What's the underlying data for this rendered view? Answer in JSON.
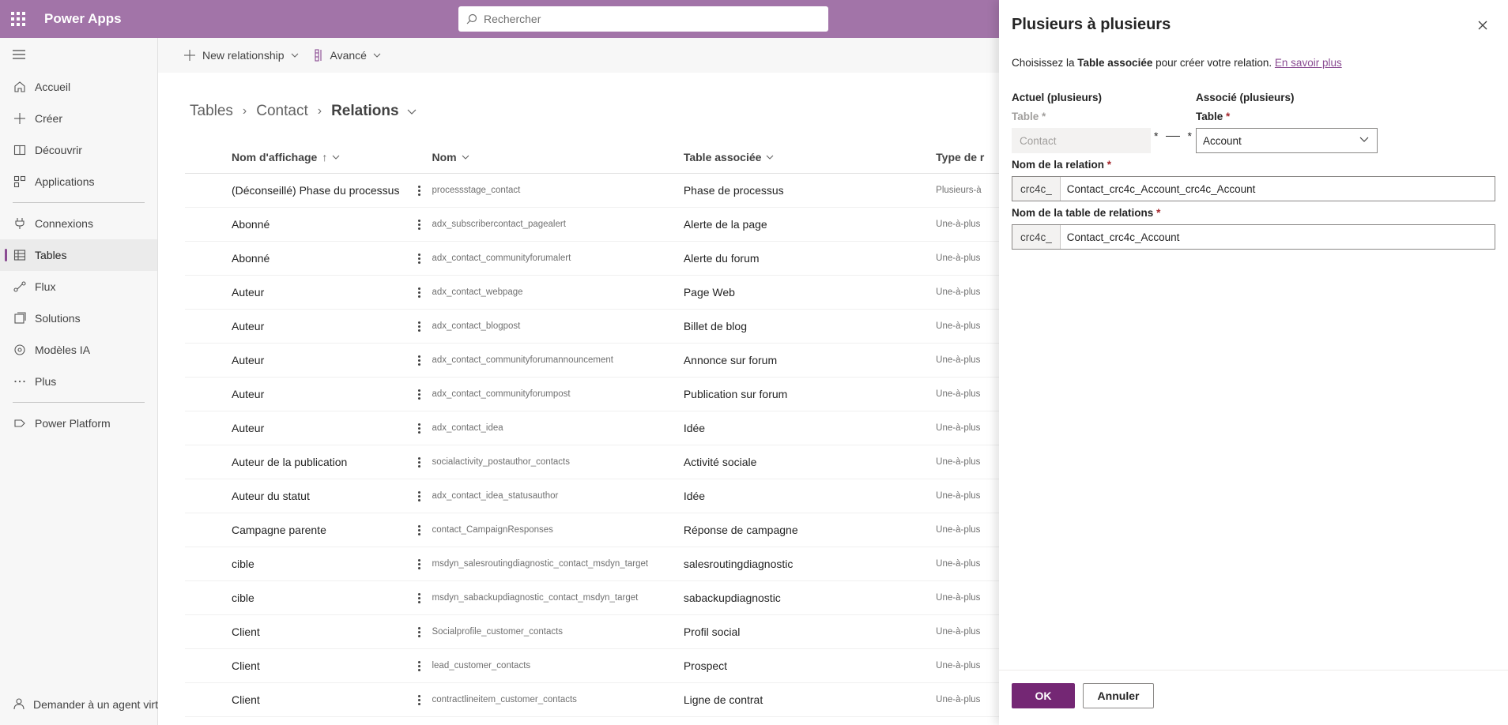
{
  "topbar": {
    "app_name": "Power Apps",
    "search_placeholder": "Rechercher"
  },
  "nav": {
    "items": [
      {
        "label": "Accueil",
        "icon": "home-icon"
      },
      {
        "label": "Créer",
        "icon": "plus-icon"
      },
      {
        "label": "Découvrir",
        "icon": "book-icon"
      },
      {
        "label": "Applications",
        "icon": "apps-icon"
      },
      {
        "label": "Connexions",
        "icon": "plug-icon"
      },
      {
        "label": "Tables",
        "icon": "table-icon",
        "active": true
      },
      {
        "label": "Flux",
        "icon": "flow-icon"
      },
      {
        "label": "Solutions",
        "icon": "solutions-icon"
      },
      {
        "label": "Modèles IA",
        "icon": "ai-models-icon"
      },
      {
        "label": "Plus",
        "icon": "more-icon"
      },
      {
        "label": "Power Platform",
        "icon": "power-platform-icon"
      }
    ],
    "bottom": "Demander à un agent virt"
  },
  "commandbar": {
    "new_relationship": "New relationship",
    "advanced": "Avancé"
  },
  "breadcrumb": {
    "root": "Tables",
    "table": "Contact",
    "current": "Relations"
  },
  "grid": {
    "headers": {
      "display_name": "Nom d'affichage",
      "name": "Nom",
      "related_table": "Table associée",
      "type": "Type de r"
    },
    "rows": [
      {
        "display": "(Déconseillé) Phase du processus",
        "name": "processstage_contact",
        "related": "Phase de processus",
        "type": "Plusieurs-à"
      },
      {
        "display": "Abonné",
        "name": "adx_subscribercontact_pagealert",
        "related": "Alerte de la page",
        "type": "Une-à-plus"
      },
      {
        "display": "Abonné",
        "name": "adx_contact_communityforumalert",
        "related": "Alerte du forum",
        "type": "Une-à-plus"
      },
      {
        "display": "Auteur",
        "name": "adx_contact_webpage",
        "related": "Page Web",
        "type": "Une-à-plus"
      },
      {
        "display": "Auteur",
        "name": "adx_contact_blogpost",
        "related": "Billet de blog",
        "type": "Une-à-plus"
      },
      {
        "display": "Auteur",
        "name": "adx_contact_communityforumannouncement",
        "related": "Annonce sur forum",
        "type": "Une-à-plus"
      },
      {
        "display": "Auteur",
        "name": "adx_contact_communityforumpost",
        "related": "Publication sur forum",
        "type": "Une-à-plus"
      },
      {
        "display": "Auteur",
        "name": "adx_contact_idea",
        "related": "Idée",
        "type": "Une-à-plus"
      },
      {
        "display": "Auteur de la publication",
        "name": "socialactivity_postauthor_contacts",
        "related": "Activité sociale",
        "type": "Une-à-plus"
      },
      {
        "display": "Auteur du statut",
        "name": "adx_contact_idea_statusauthor",
        "related": "Idée",
        "type": "Une-à-plus"
      },
      {
        "display": "Campagne parente",
        "name": "contact_CampaignResponses",
        "related": "Réponse de campagne",
        "type": "Une-à-plus"
      },
      {
        "display": "cible",
        "name": "msdyn_salesroutingdiagnostic_contact_msdyn_target",
        "related": "salesroutingdiagnostic",
        "type": "Une-à-plus"
      },
      {
        "display": "cible",
        "name": "msdyn_sabackupdiagnostic_contact_msdyn_target",
        "related": "sabackupdiagnostic",
        "type": "Une-à-plus"
      },
      {
        "display": "Client",
        "name": "Socialprofile_customer_contacts",
        "related": "Profil social",
        "type": "Une-à-plus"
      },
      {
        "display": "Client",
        "name": "lead_customer_contacts",
        "related": "Prospect",
        "type": "Une-à-plus"
      },
      {
        "display": "Client",
        "name": "contractlineitem_customer_contacts",
        "related": "Ligne de contrat",
        "type": "Une-à-plus"
      }
    ]
  },
  "panel": {
    "title": "Plusieurs à plusieurs",
    "desc_pre": "Choisissez la ",
    "desc_bold": "Table associée",
    "desc_post": " pour créer votre relation. ",
    "desc_link": "En savoir plus",
    "current_heading": "Actuel (plusieurs)",
    "related_heading": "Associé (plusieurs)",
    "table_label": "Table",
    "required_mark": "*",
    "current_table_value": "Contact",
    "connector_left": "*",
    "connector_right": "*",
    "related_table_value": "Account",
    "relation_name_label": "Nom de la relation",
    "relation_prefix": "crc4c_",
    "relation_name_value": "Contact_crc4c_Account_crc4c_Account",
    "relation_table_label": "Nom de la table de relations",
    "relation_table_prefix": "crc4c_",
    "relation_table_value": "Contact_crc4c_Account",
    "ok": "OK",
    "cancel": "Annuler"
  },
  "colors": {
    "header_bg": "#a274a8",
    "accent": "#742774",
    "link": "#8a4b92"
  }
}
